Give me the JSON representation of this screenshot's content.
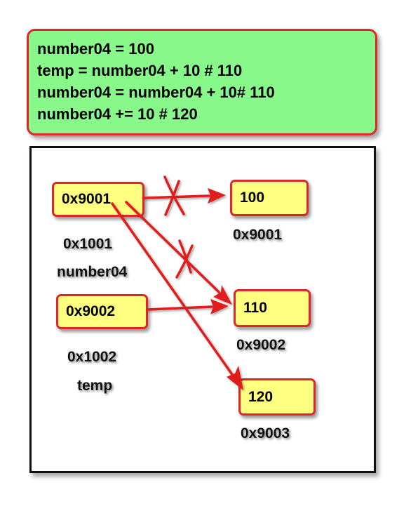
{
  "code": {
    "lines": [
      "number04 = 100",
      "temp = number04 + 10 # 110",
      "number04 = number04 + 10# 110",
      "number04 += 10 # 120"
    ]
  },
  "variables": {
    "number04": {
      "value": "0x9001",
      "address": "0x1001",
      "name": "number04"
    },
    "temp": {
      "value": "0x9002",
      "address": "0x1002",
      "name": "temp"
    }
  },
  "objects": [
    {
      "value": "100",
      "address": "0x9001"
    },
    {
      "value": "110",
      "address": "0x9002"
    },
    {
      "value": "120",
      "address": "0x9003"
    }
  ],
  "colors": {
    "code_bg": "#88f88a",
    "cell_bg": "#ffff80",
    "accent": "#e0262a"
  }
}
